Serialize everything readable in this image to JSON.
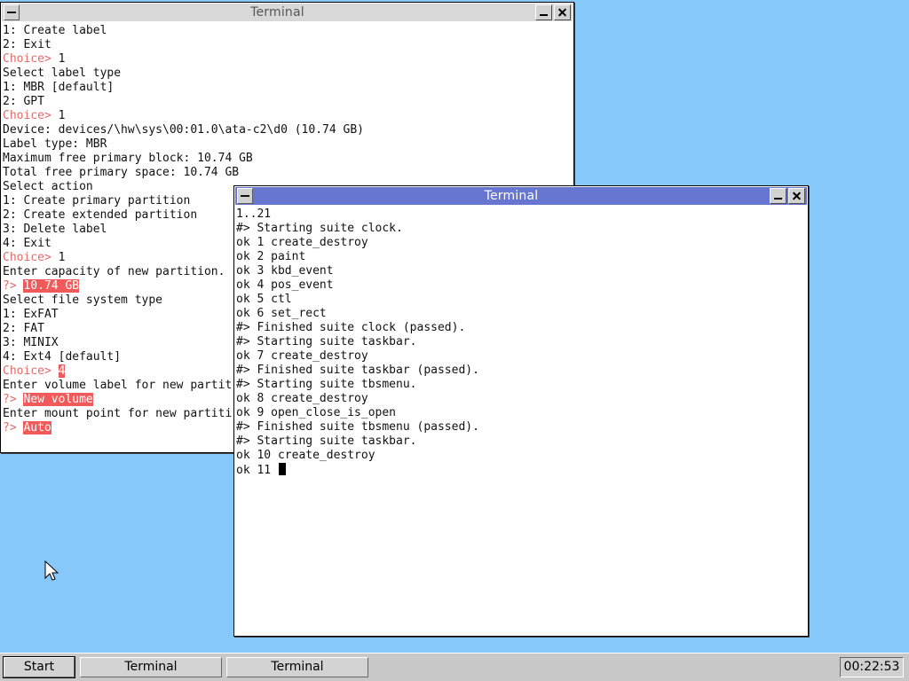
{
  "windows": {
    "back": {
      "title": "Terminal",
      "lines": [
        [
          {
            "t": "1: Create label",
            "k": "text"
          }
        ],
        [
          {
            "t": "2: Exit",
            "k": "text"
          }
        ],
        [
          {
            "t": "Choice> ",
            "k": "prompt"
          },
          {
            "t": "1",
            "k": "text"
          }
        ],
        [
          {
            "t": "Select label type",
            "k": "text"
          }
        ],
        [
          {
            "t": "1: MBR [default]",
            "k": "text"
          }
        ],
        [
          {
            "t": "2: GPT",
            "k": "text"
          }
        ],
        [
          {
            "t": "Choice> ",
            "k": "prompt"
          },
          {
            "t": "1",
            "k": "text"
          }
        ],
        [
          {
            "t": "Device: devices/\\hw\\sys\\00:01.0\\ata-c2\\d0 (10.74 GB)",
            "k": "text"
          }
        ],
        [
          {
            "t": "Label type: MBR",
            "k": "text"
          }
        ],
        [
          {
            "t": "Maximum free primary block: 10.74 GB",
            "k": "text"
          }
        ],
        [
          {
            "t": "Total free primary space: 10.74 GB",
            "k": "text"
          }
        ],
        [
          {
            "t": "Select action",
            "k": "text"
          }
        ],
        [
          {
            "t": "1: Create primary partition",
            "k": "text"
          }
        ],
        [
          {
            "t": "2: Create extended partition",
            "k": "text"
          }
        ],
        [
          {
            "t": "3: Delete label",
            "k": "text"
          }
        ],
        [
          {
            "t": "4: Exit",
            "k": "text"
          }
        ],
        [
          {
            "t": "Choice> ",
            "k": "prompt"
          },
          {
            "t": "1",
            "k": "text"
          }
        ],
        [
          {
            "t": "Enter capacity of new partition.",
            "k": "text"
          }
        ],
        [
          {
            "t": "?> ",
            "k": "prompt"
          },
          {
            "t": "10.74 GB",
            "k": "highlight"
          }
        ],
        [
          {
            "t": "Select file system type",
            "k": "text"
          }
        ],
        [
          {
            "t": "1: ExFAT",
            "k": "text"
          }
        ],
        [
          {
            "t": "2: FAT",
            "k": "text"
          }
        ],
        [
          {
            "t": "3: MINIX",
            "k": "text"
          }
        ],
        [
          {
            "t": "4: Ext4 [default]",
            "k": "text"
          }
        ],
        [
          {
            "t": "Choice> ",
            "k": "prompt"
          },
          {
            "t": "4",
            "k": "highlight"
          }
        ],
        [
          {
            "t": "Enter volume label for new partit",
            "k": "text"
          }
        ],
        [
          {
            "t": "?> ",
            "k": "prompt"
          },
          {
            "t": "New volume",
            "k": "highlight"
          }
        ],
        [
          {
            "t": "Enter mount point for new partiti",
            "k": "text"
          }
        ],
        [
          {
            "t": "?> ",
            "k": "prompt"
          },
          {
            "t": "Auto",
            "k": "highlight"
          }
        ]
      ]
    },
    "front": {
      "title": "Terminal",
      "lines": [
        [
          {
            "t": "1..21",
            "k": "text"
          }
        ],
        [
          {
            "t": "#> Starting suite clock.",
            "k": "text"
          }
        ],
        [
          {
            "t": "ok 1 create_destroy",
            "k": "text"
          }
        ],
        [
          {
            "t": "ok 2 paint",
            "k": "text"
          }
        ],
        [
          {
            "t": "ok 3 kbd_event",
            "k": "text"
          }
        ],
        [
          {
            "t": "ok 4 pos_event",
            "k": "text"
          }
        ],
        [
          {
            "t": "ok 5 ctl",
            "k": "text"
          }
        ],
        [
          {
            "t": "ok 6 set_rect",
            "k": "text"
          }
        ],
        [
          {
            "t": "#> Finished suite clock (passed).",
            "k": "text"
          }
        ],
        [
          {
            "t": "#> Starting suite taskbar.",
            "k": "text"
          }
        ],
        [
          {
            "t": "ok 7 create_destroy",
            "k": "text"
          }
        ],
        [
          {
            "t": "#> Finished suite taskbar (passed).",
            "k": "text"
          }
        ],
        [
          {
            "t": "#> Starting suite tbsmenu.",
            "k": "text"
          }
        ],
        [
          {
            "t": "ok 8 create_destroy",
            "k": "text"
          }
        ],
        [
          {
            "t": "ok 9 open_close_is_open",
            "k": "text"
          }
        ],
        [
          {
            "t": "#> Finished suite tbsmenu (passed).",
            "k": "text"
          }
        ],
        [
          {
            "t": "#> Starting suite taskbar.",
            "k": "text"
          }
        ],
        [
          {
            "t": "ok 10 create_destroy",
            "k": "text"
          }
        ],
        [
          {
            "t": "ok 11 ",
            "k": "text"
          },
          {
            "t": "",
            "k": "cursor"
          }
        ]
      ]
    }
  },
  "taskbar": {
    "start_label": "Start",
    "task_buttons": [
      "Terminal",
      "Terminal"
    ],
    "clock": "00:22:53"
  },
  "icons": {
    "window_menu": "window-menu-icon",
    "minimize": "minimize-icon",
    "close": "close-icon",
    "mouse_pointer": "mouse-pointer-icon"
  },
  "colors": {
    "desktop": "#87c8fa",
    "active_titlebar": "#6777d1",
    "inactive_titlebar": "#d8d8d8",
    "prompt": "#e06b6b",
    "highlight": "#f05a5a",
    "taskbar": "#c8c8c8"
  }
}
